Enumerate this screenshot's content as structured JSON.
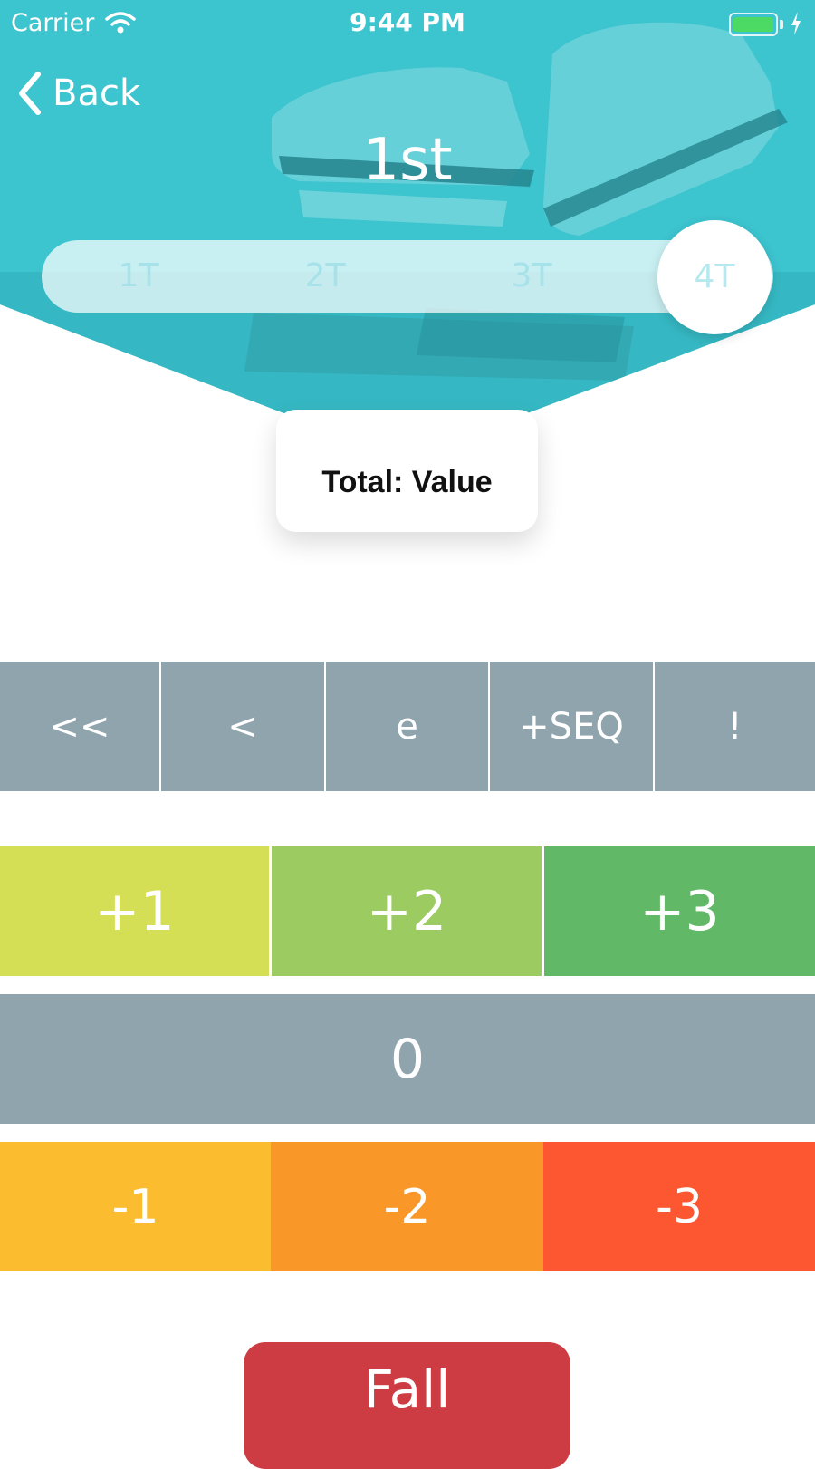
{
  "status_bar": {
    "carrier": "Carrier",
    "time": "9:44 PM",
    "wifi_icon": "wifi-icon",
    "battery_icon": "battery-icon",
    "charging_icon": "bolt-icon",
    "battery_color": "#4cd964"
  },
  "header": {
    "back_label": "Back",
    "back_icon": "chevron-left-icon",
    "title": "1st",
    "background_image": "ice-skates photo with teal overlay",
    "overlay_color": "#3cc5cf"
  },
  "jump_selector": {
    "options": [
      "1T",
      "2T",
      "3T",
      "4T"
    ],
    "selected": "4T"
  },
  "total": {
    "label": "Total: Value"
  },
  "modifiers": {
    "buttons": [
      "<<",
      "<",
      "e",
      "+SEQ",
      "!"
    ],
    "color": "#90a4ae"
  },
  "goe": {
    "positive": [
      {
        "label": "+1",
        "color": "#d5df55"
      },
      {
        "label": "+2",
        "color": "#9bcb61"
      },
      {
        "label": "+3",
        "color": "#61b867"
      }
    ],
    "zero": {
      "label": "0",
      "color": "#90a4ae"
    },
    "negative": [
      {
        "label": "-1",
        "color": "#fbbd2f"
      },
      {
        "label": "-2",
        "color": "#f99828"
      },
      {
        "label": "-3",
        "color": "#fc5730"
      }
    ]
  },
  "fall": {
    "label": "Fall",
    "color": "#cd3c42"
  }
}
